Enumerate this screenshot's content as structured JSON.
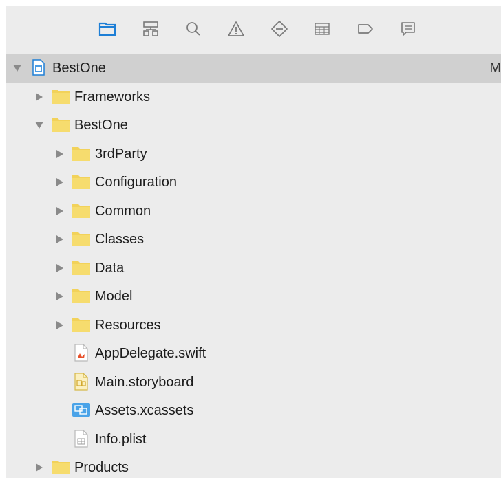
{
  "toolbar": {
    "icons": [
      {
        "name": "project-navigator-icon",
        "active": true
      },
      {
        "name": "symbol-navigator-icon",
        "active": false
      },
      {
        "name": "find-navigator-icon",
        "active": false
      },
      {
        "name": "issue-navigator-icon",
        "active": false
      },
      {
        "name": "test-navigator-icon",
        "active": false
      },
      {
        "name": "debug-navigator-icon",
        "active": false
      },
      {
        "name": "breakpoint-navigator-icon",
        "active": false
      },
      {
        "name": "report-navigator-icon",
        "active": false
      }
    ]
  },
  "colors": {
    "accent": "#1e7fd6",
    "folder": "#f2d25a",
    "selected_row": "#d0d0d0",
    "panel_bg": "#ececec"
  },
  "tree": {
    "project": {
      "label": "BestOne",
      "badge": "M",
      "icon": "xcode-project-icon",
      "expanded": true
    },
    "frameworks": {
      "label": "Frameworks",
      "icon": "folder-icon",
      "expanded": false
    },
    "bestone_group": {
      "label": "BestOne",
      "icon": "folder-icon",
      "expanded": true
    },
    "children": [
      {
        "label": "3rdParty",
        "icon": "folder-icon"
      },
      {
        "label": "Configuration",
        "icon": "folder-icon"
      },
      {
        "label": "Common",
        "icon": "folder-icon"
      },
      {
        "label": "Classes",
        "icon": "folder-icon"
      },
      {
        "label": "Data",
        "icon": "folder-icon"
      },
      {
        "label": "Model",
        "icon": "folder-icon"
      },
      {
        "label": "Resources",
        "icon": "folder-icon"
      }
    ],
    "files": [
      {
        "label": "AppDelegate.swift",
        "icon": "swift-file-icon"
      },
      {
        "label": "Main.storyboard",
        "icon": "storyboard-file-icon"
      },
      {
        "label": "Assets.xcassets",
        "icon": "asset-catalog-icon"
      },
      {
        "label": "Info.plist",
        "icon": "plist-file-icon"
      }
    ],
    "products": {
      "label": "Products",
      "icon": "folder-icon",
      "expanded": false
    }
  }
}
